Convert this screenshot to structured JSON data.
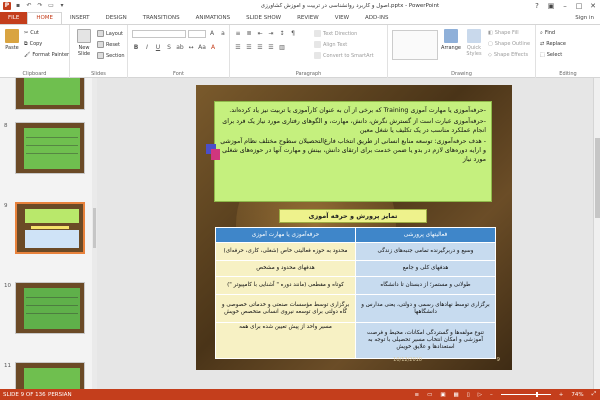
{
  "app": {
    "title": "اصول و کاربرد روانشناسی در تربیت و آموزش کشاورزی.pptx - PowerPoint",
    "sign_in": "Sign in",
    "quick_access": [
      "save-icon",
      "undo-icon",
      "redo-icon",
      "slideshow-icon",
      "more-icon"
    ]
  },
  "tabs": [
    {
      "label": "FILE"
    },
    {
      "label": "HOME"
    },
    {
      "label": "INSERT"
    },
    {
      "label": "DESIGN"
    },
    {
      "label": "TRANSITIONS"
    },
    {
      "label": "ANIMATIONS"
    },
    {
      "label": "SLIDE SHOW"
    },
    {
      "label": "REVIEW"
    },
    {
      "label": "VIEW"
    },
    {
      "label": "ADD-INS"
    }
  ],
  "ribbon": {
    "clipboard": {
      "label": "Clipboard",
      "paste": "Paste",
      "cut": "Cut",
      "copy": "Copy",
      "format_painter": "Format Painter"
    },
    "slides": {
      "label": "Slides",
      "new_slide": "New Slide",
      "layout": "Layout",
      "reset": "Reset",
      "section": "Section"
    },
    "font": {
      "label": "Font"
    },
    "paragraph": {
      "label": "Paragraph",
      "text_direction": "Text Direction",
      "align_text": "Align Text",
      "convert": "Convert to SmartArt"
    },
    "drawing": {
      "label": "Drawing",
      "arrange": "Arrange",
      "quick_styles": "Quick Styles",
      "shape_fill": "Shape Fill",
      "shape_outline": "Shape Outline",
      "shape_effects": "Shape Effects"
    },
    "editing": {
      "label": "Editing",
      "find": "Find",
      "replace": "Replace",
      "select": "Select"
    }
  },
  "thumbnails": [
    {
      "num": "8"
    },
    {
      "num": "9"
    },
    {
      "num": "10"
    },
    {
      "num": "11"
    }
  ],
  "slide": {
    "para1": "-حرفه‌آموزی یا مهارت آموزی Training که برخی از آن به عنوان کارآموزی یا تربیت نیز یاد کرده‌اند.",
    "para2": "-حرفه‌آموزی عبارت است از گسترش نگرش، دانش، مهارت، و الگوهای رفتاری مورد نیاز یک فرد برای انجام عملکرد مناسب در یک تکلیف یا شغل معین",
    "para3": "- هدف حرفه‌آموزی: توسعه منابع انسانی از طریق انتخاب فارغ‌التحصیلان سطوح مختلف نظام آموزشی و ارایه دوره‌های لازم در بدو یا ضمن خدمت برای ارتقای دانش، بینش و مهارت آنها در حوزه‌های شغلی مورد نیاز",
    "heading": "تمایز پرورش و حرفه آموزی",
    "table": {
      "headers": [
        "فعالیتهای پرورشی",
        "حرفه‌آموزی یا مهارت آموزی"
      ],
      "rows": [
        [
          "وسیع و دربرگیرنده تمامی جنبه‌های زندگی",
          "محدود به حوزه فعالیتی خاص (شغلی، کاری، حرفه‌ای)"
        ],
        [
          "هدفهای کلی و جامع",
          "هدفهای محدود و مشخص"
        ],
        [
          "طولانی و مستمر؛ از دبستان تا دانشگاه",
          "کوتاه و مقطعی (مانند دوره \" آشنایی با کامپیوتر \")"
        ],
        [
          "برگزاری توسط نهادهای رسمی و دولتی، یعنی مدارس و دانشگاهها",
          "برگزاری توسط مؤسسات صنعتی و خدماتی خصوصی و گاه دولتی برای توسعه نیروی انسانی متخصص خویش"
        ],
        [
          "تنوع مولفه‌ها و گستردگی امکانات، محیط و فرصت آموزشی و امکان انتخاب مسیر تحصیلی با توجه به استعدادها و علایق خویش",
          "مسیر واحد از پیش تعیین شده برای همه"
        ]
      ]
    },
    "page_number": "9",
    "footer_date": "10/12/2010"
  },
  "status": {
    "slide_info": "SLIDE 9 OF 136",
    "language": "PERSIAN",
    "zoom": "74%"
  },
  "colors": {
    "accent": "#c43e1c",
    "slide_green": "#c5f07e",
    "table_header": "#3f86c9"
  }
}
